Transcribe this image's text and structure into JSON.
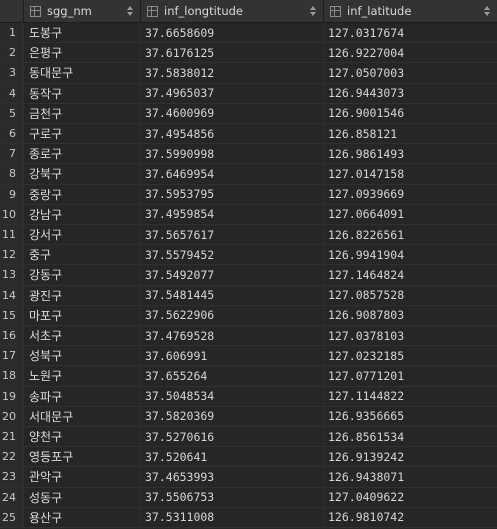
{
  "columns": [
    {
      "label": "sgg_nm",
      "icon": "table-column-icon"
    },
    {
      "label": "inf_longtitude",
      "icon": "table-column-icon"
    },
    {
      "label": "inf_latitude",
      "icon": "table-column-icon"
    }
  ],
  "rows": [
    {
      "n": "1",
      "sgg_nm": "도봉구",
      "inf_longtitude": "37.6658609",
      "inf_latitude": "127.0317674"
    },
    {
      "n": "2",
      "sgg_nm": "은평구",
      "inf_longtitude": "37.6176125",
      "inf_latitude": "126.9227004"
    },
    {
      "n": "3",
      "sgg_nm": "동대문구",
      "inf_longtitude": "37.5838012",
      "inf_latitude": "127.0507003"
    },
    {
      "n": "4",
      "sgg_nm": "동작구",
      "inf_longtitude": "37.4965037",
      "inf_latitude": "126.9443073"
    },
    {
      "n": "5",
      "sgg_nm": "금천구",
      "inf_longtitude": "37.4600969",
      "inf_latitude": "126.9001546"
    },
    {
      "n": "6",
      "sgg_nm": "구로구",
      "inf_longtitude": "37.4954856",
      "inf_latitude": "126.858121"
    },
    {
      "n": "7",
      "sgg_nm": "종로구",
      "inf_longtitude": "37.5990998",
      "inf_latitude": "126.9861493"
    },
    {
      "n": "8",
      "sgg_nm": "강북구",
      "inf_longtitude": "37.6469954",
      "inf_latitude": "127.0147158"
    },
    {
      "n": "9",
      "sgg_nm": "중랑구",
      "inf_longtitude": "37.5953795",
      "inf_latitude": "127.0939669"
    },
    {
      "n": "10",
      "sgg_nm": "강남구",
      "inf_longtitude": "37.4959854",
      "inf_latitude": "127.0664091"
    },
    {
      "n": "11",
      "sgg_nm": "강서구",
      "inf_longtitude": "37.5657617",
      "inf_latitude": "126.8226561"
    },
    {
      "n": "12",
      "sgg_nm": "중구",
      "inf_longtitude": "37.5579452",
      "inf_latitude": "126.9941904"
    },
    {
      "n": "13",
      "sgg_nm": "강동구",
      "inf_longtitude": "37.5492077",
      "inf_latitude": "127.1464824"
    },
    {
      "n": "14",
      "sgg_nm": "광진구",
      "inf_longtitude": "37.5481445",
      "inf_latitude": "127.0857528"
    },
    {
      "n": "15",
      "sgg_nm": "마포구",
      "inf_longtitude": "37.5622906",
      "inf_latitude": "126.9087803"
    },
    {
      "n": "16",
      "sgg_nm": "서초구",
      "inf_longtitude": "37.4769528",
      "inf_latitude": "127.0378103"
    },
    {
      "n": "17",
      "sgg_nm": "성북구",
      "inf_longtitude": "37.606991",
      "inf_latitude": "127.0232185"
    },
    {
      "n": "18",
      "sgg_nm": "노원구",
      "inf_longtitude": "37.655264",
      "inf_latitude": "127.0771201"
    },
    {
      "n": "19",
      "sgg_nm": "송파구",
      "inf_longtitude": "37.5048534",
      "inf_latitude": "127.1144822"
    },
    {
      "n": "20",
      "sgg_nm": "서대문구",
      "inf_longtitude": "37.5820369",
      "inf_latitude": "126.9356665"
    },
    {
      "n": "21",
      "sgg_nm": "양천구",
      "inf_longtitude": "37.5270616",
      "inf_latitude": "126.8561534"
    },
    {
      "n": "22",
      "sgg_nm": "영등포구",
      "inf_longtitude": "37.520641",
      "inf_latitude": "126.9139242"
    },
    {
      "n": "23",
      "sgg_nm": "관악구",
      "inf_longtitude": "37.4653993",
      "inf_latitude": "126.9438071"
    },
    {
      "n": "24",
      "sgg_nm": "성동구",
      "inf_longtitude": "37.5506753",
      "inf_latitude": "127.0409622"
    },
    {
      "n": "25",
      "sgg_nm": "용산구",
      "inf_longtitude": "37.5311008",
      "inf_latitude": "126.9810742"
    }
  ],
  "colors": {
    "background": "#262626",
    "header_background": "#333333",
    "text": "#d6d6d6"
  }
}
